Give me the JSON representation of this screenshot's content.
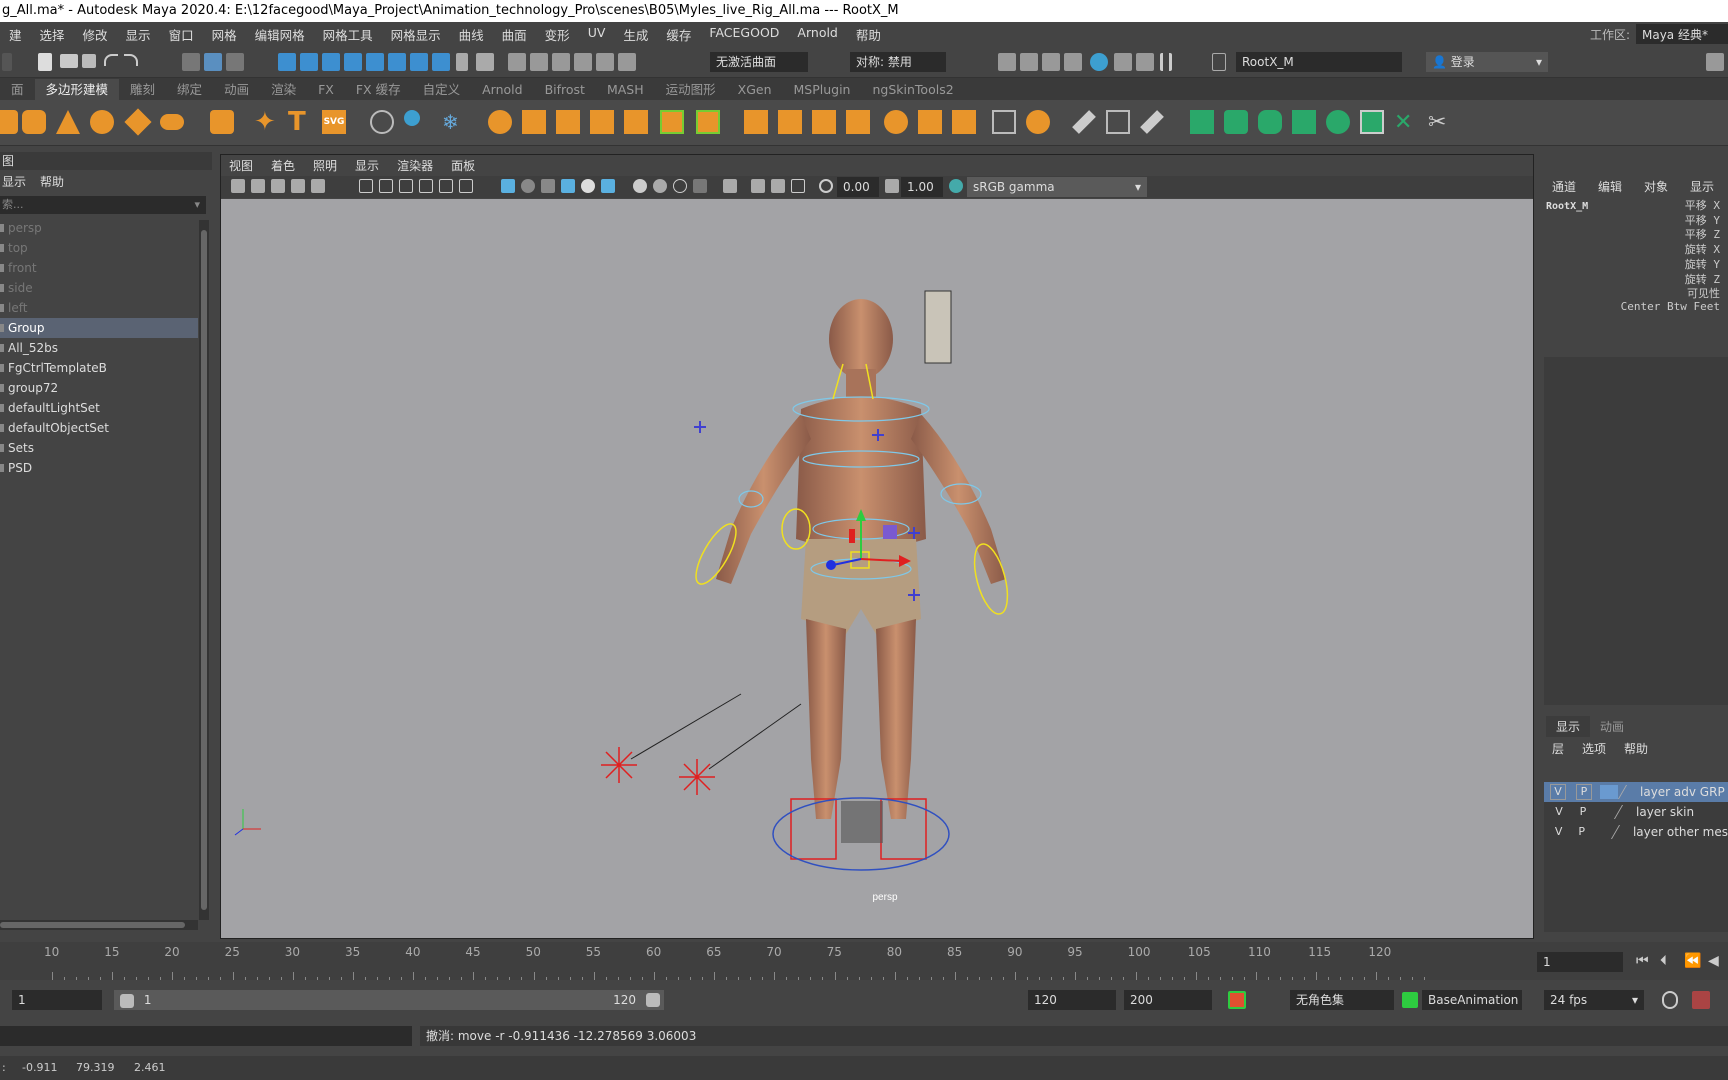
{
  "title": "g_All.ma* - Autodesk Maya 2020.4: E:\\12facegood\\Maya_Project\\Animation_technology_Pro\\scenes\\B05\\Myles_live_Rig_All.ma   ---   RootX_M",
  "menubar": {
    "items": [
      "建",
      "选择",
      "修改",
      "显示",
      "窗口",
      "网格",
      "编辑网格",
      "网格工具",
      "网格显示",
      "曲线",
      "曲面",
      "变形",
      "UV",
      "生成",
      "缓存",
      "FACEGOOD",
      "Arnold",
      "帮助"
    ],
    "workspace_label": "工作区:",
    "workspace_value": "Maya 经典*"
  },
  "statusline": {
    "live_surface": "无激活曲面",
    "symmetry": "对称: 禁用",
    "node_field": "RootX_M",
    "login": "登录"
  },
  "shelf_tabs": [
    "面",
    "多边形建模",
    "雕刻",
    "绑定",
    "动画",
    "渲染",
    "FX",
    "FX 缓存",
    "自定义",
    "Arnold",
    "Bifrost",
    "MASH",
    "运动图形",
    "XGen",
    "MSPlugin",
    "ngSkinTools2"
  ],
  "shelf_active": "多边形建模",
  "outliner": {
    "header": "图",
    "menu": [
      "显示",
      "帮助"
    ],
    "search_placeholder": "索...",
    "items": [
      {
        "label": "persp",
        "dim": true
      },
      {
        "label": "top",
        "dim": true
      },
      {
        "label": "front",
        "dim": true
      },
      {
        "label": "side",
        "dim": true
      },
      {
        "label": "left",
        "dim": true
      },
      {
        "label": "Group",
        "sel": true
      },
      {
        "label": "All_52bs"
      },
      {
        "label": "FgCtrlTemplateB"
      },
      {
        "label": "group72"
      },
      {
        "label": "defaultLightSet"
      },
      {
        "label": "defaultObjectSet"
      },
      {
        "label": "Sets"
      },
      {
        "label": "PSD"
      }
    ]
  },
  "viewport": {
    "menu": [
      "视图",
      "着色",
      "照明",
      "显示",
      "渲染器",
      "面板"
    ],
    "exposure": "0.00",
    "gamma": "1.00",
    "colorspace": "sRGB gamma",
    "camera_label": "persp"
  },
  "channelbox": {
    "menu": [
      "通道",
      "编辑",
      "对象",
      "显示"
    ],
    "node": "RootX_M",
    "attrs": [
      "平移 X",
      "平移 Y",
      "平移 Z",
      "旋转 X",
      "旋转 Y",
      "旋转 Z",
      "可见性",
      "Center Btw Feet"
    ]
  },
  "layers": {
    "tabs": [
      "显示",
      "动画"
    ],
    "menu": [
      "层",
      "选项",
      "帮助"
    ],
    "rows": [
      {
        "v": "V",
        "p": "P",
        "name": "layer adv GRP",
        "sel": true
      },
      {
        "v": "V",
        "p": "P",
        "name": "layer skin"
      },
      {
        "v": "V",
        "p": "P",
        "name": "layer other mes"
      }
    ]
  },
  "timeline": {
    "ticks": [
      "10",
      "15",
      "20",
      "25",
      "30",
      "35",
      "40",
      "45",
      "50",
      "55",
      "60",
      "65",
      "70",
      "75",
      "80",
      "85",
      "90",
      "95",
      "100",
      "105",
      "110",
      "115",
      "120"
    ],
    "current_frame": "1"
  },
  "range": {
    "start": "1",
    "slider_start": "1",
    "slider_end": "120",
    "end": "120",
    "max": "200",
    "char_set": "无角色集",
    "anim_layer": "BaseAnimation",
    "fps": "24 fps"
  },
  "command": {
    "feedback": "撤消: move -r -0.911436 -12.278569 3.06003"
  },
  "coords": {
    "x": "-0.911",
    "y": "79.319",
    "z": "2.461"
  }
}
